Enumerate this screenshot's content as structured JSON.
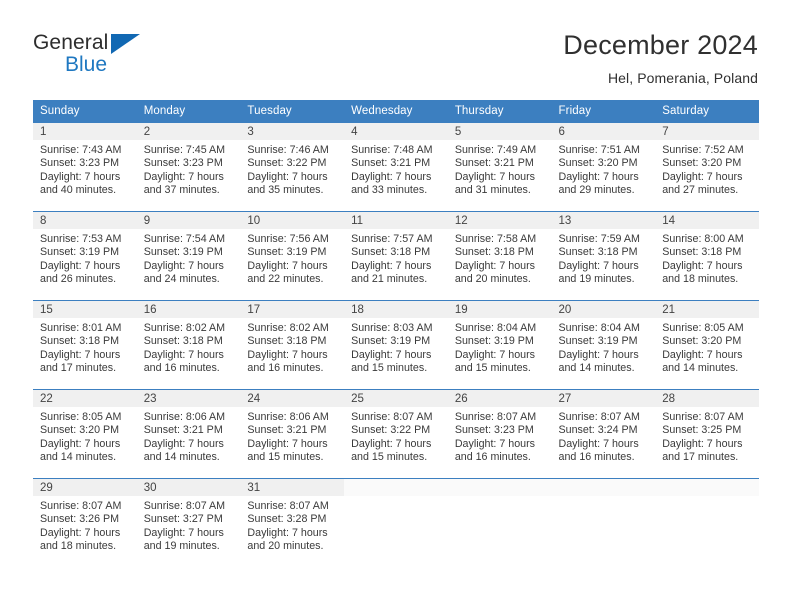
{
  "brand": {
    "name_top": "General",
    "name_bottom": "Blue",
    "accent_color": "#1168b3"
  },
  "header": {
    "title": "December 2024",
    "subtitle": "Hel, Pomerania, Poland"
  },
  "calendar": {
    "header_bg": "#3c7fc0",
    "daynum_bg": "#f0f0f0",
    "weekdays": [
      "Sunday",
      "Monday",
      "Tuesday",
      "Wednesday",
      "Thursday",
      "Friday",
      "Saturday"
    ],
    "weeks": [
      [
        {
          "day": "1",
          "sunrise": "Sunrise: 7:43 AM",
          "sunset": "Sunset: 3:23 PM",
          "daylight1": "Daylight: 7 hours",
          "daylight2": "and 40 minutes."
        },
        {
          "day": "2",
          "sunrise": "Sunrise: 7:45 AM",
          "sunset": "Sunset: 3:23 PM",
          "daylight1": "Daylight: 7 hours",
          "daylight2": "and 37 minutes."
        },
        {
          "day": "3",
          "sunrise": "Sunrise: 7:46 AM",
          "sunset": "Sunset: 3:22 PM",
          "daylight1": "Daylight: 7 hours",
          "daylight2": "and 35 minutes."
        },
        {
          "day": "4",
          "sunrise": "Sunrise: 7:48 AM",
          "sunset": "Sunset: 3:21 PM",
          "daylight1": "Daylight: 7 hours",
          "daylight2": "and 33 minutes."
        },
        {
          "day": "5",
          "sunrise": "Sunrise: 7:49 AM",
          "sunset": "Sunset: 3:21 PM",
          "daylight1": "Daylight: 7 hours",
          "daylight2": "and 31 minutes."
        },
        {
          "day": "6",
          "sunrise": "Sunrise: 7:51 AM",
          "sunset": "Sunset: 3:20 PM",
          "daylight1": "Daylight: 7 hours",
          "daylight2": "and 29 minutes."
        },
        {
          "day": "7",
          "sunrise": "Sunrise: 7:52 AM",
          "sunset": "Sunset: 3:20 PM",
          "daylight1": "Daylight: 7 hours",
          "daylight2": "and 27 minutes."
        }
      ],
      [
        {
          "day": "8",
          "sunrise": "Sunrise: 7:53 AM",
          "sunset": "Sunset: 3:19 PM",
          "daylight1": "Daylight: 7 hours",
          "daylight2": "and 26 minutes."
        },
        {
          "day": "9",
          "sunrise": "Sunrise: 7:54 AM",
          "sunset": "Sunset: 3:19 PM",
          "daylight1": "Daylight: 7 hours",
          "daylight2": "and 24 minutes."
        },
        {
          "day": "10",
          "sunrise": "Sunrise: 7:56 AM",
          "sunset": "Sunset: 3:19 PM",
          "daylight1": "Daylight: 7 hours",
          "daylight2": "and 22 minutes."
        },
        {
          "day": "11",
          "sunrise": "Sunrise: 7:57 AM",
          "sunset": "Sunset: 3:18 PM",
          "daylight1": "Daylight: 7 hours",
          "daylight2": "and 21 minutes."
        },
        {
          "day": "12",
          "sunrise": "Sunrise: 7:58 AM",
          "sunset": "Sunset: 3:18 PM",
          "daylight1": "Daylight: 7 hours",
          "daylight2": "and 20 minutes."
        },
        {
          "day": "13",
          "sunrise": "Sunrise: 7:59 AM",
          "sunset": "Sunset: 3:18 PM",
          "daylight1": "Daylight: 7 hours",
          "daylight2": "and 19 minutes."
        },
        {
          "day": "14",
          "sunrise": "Sunrise: 8:00 AM",
          "sunset": "Sunset: 3:18 PM",
          "daylight1": "Daylight: 7 hours",
          "daylight2": "and 18 minutes."
        }
      ],
      [
        {
          "day": "15",
          "sunrise": "Sunrise: 8:01 AM",
          "sunset": "Sunset: 3:18 PM",
          "daylight1": "Daylight: 7 hours",
          "daylight2": "and 17 minutes."
        },
        {
          "day": "16",
          "sunrise": "Sunrise: 8:02 AM",
          "sunset": "Sunset: 3:18 PM",
          "daylight1": "Daylight: 7 hours",
          "daylight2": "and 16 minutes."
        },
        {
          "day": "17",
          "sunrise": "Sunrise: 8:02 AM",
          "sunset": "Sunset: 3:18 PM",
          "daylight1": "Daylight: 7 hours",
          "daylight2": "and 16 minutes."
        },
        {
          "day": "18",
          "sunrise": "Sunrise: 8:03 AM",
          "sunset": "Sunset: 3:19 PM",
          "daylight1": "Daylight: 7 hours",
          "daylight2": "and 15 minutes."
        },
        {
          "day": "19",
          "sunrise": "Sunrise: 8:04 AM",
          "sunset": "Sunset: 3:19 PM",
          "daylight1": "Daylight: 7 hours",
          "daylight2": "and 15 minutes."
        },
        {
          "day": "20",
          "sunrise": "Sunrise: 8:04 AM",
          "sunset": "Sunset: 3:19 PM",
          "daylight1": "Daylight: 7 hours",
          "daylight2": "and 14 minutes."
        },
        {
          "day": "21",
          "sunrise": "Sunrise: 8:05 AM",
          "sunset": "Sunset: 3:20 PM",
          "daylight1": "Daylight: 7 hours",
          "daylight2": "and 14 minutes."
        }
      ],
      [
        {
          "day": "22",
          "sunrise": "Sunrise: 8:05 AM",
          "sunset": "Sunset: 3:20 PM",
          "daylight1": "Daylight: 7 hours",
          "daylight2": "and 14 minutes."
        },
        {
          "day": "23",
          "sunrise": "Sunrise: 8:06 AM",
          "sunset": "Sunset: 3:21 PM",
          "daylight1": "Daylight: 7 hours",
          "daylight2": "and 14 minutes."
        },
        {
          "day": "24",
          "sunrise": "Sunrise: 8:06 AM",
          "sunset": "Sunset: 3:21 PM",
          "daylight1": "Daylight: 7 hours",
          "daylight2": "and 15 minutes."
        },
        {
          "day": "25",
          "sunrise": "Sunrise: 8:07 AM",
          "sunset": "Sunset: 3:22 PM",
          "daylight1": "Daylight: 7 hours",
          "daylight2": "and 15 minutes."
        },
        {
          "day": "26",
          "sunrise": "Sunrise: 8:07 AM",
          "sunset": "Sunset: 3:23 PM",
          "daylight1": "Daylight: 7 hours",
          "daylight2": "and 16 minutes."
        },
        {
          "day": "27",
          "sunrise": "Sunrise: 8:07 AM",
          "sunset": "Sunset: 3:24 PM",
          "daylight1": "Daylight: 7 hours",
          "daylight2": "and 16 minutes."
        },
        {
          "day": "28",
          "sunrise": "Sunrise: 8:07 AM",
          "sunset": "Sunset: 3:25 PM",
          "daylight1": "Daylight: 7 hours",
          "daylight2": "and 17 minutes."
        }
      ],
      [
        {
          "day": "29",
          "sunrise": "Sunrise: 8:07 AM",
          "sunset": "Sunset: 3:26 PM",
          "daylight1": "Daylight: 7 hours",
          "daylight2": "and 18 minutes."
        },
        {
          "day": "30",
          "sunrise": "Sunrise: 8:07 AM",
          "sunset": "Sunset: 3:27 PM",
          "daylight1": "Daylight: 7 hours",
          "daylight2": "and 19 minutes."
        },
        {
          "day": "31",
          "sunrise": "Sunrise: 8:07 AM",
          "sunset": "Sunset: 3:28 PM",
          "daylight1": "Daylight: 7 hours",
          "daylight2": "and 20 minutes."
        },
        {
          "day": "",
          "sunrise": "",
          "sunset": "",
          "daylight1": "",
          "daylight2": ""
        },
        {
          "day": "",
          "sunrise": "",
          "sunset": "",
          "daylight1": "",
          "daylight2": ""
        },
        {
          "day": "",
          "sunrise": "",
          "sunset": "",
          "daylight1": "",
          "daylight2": ""
        },
        {
          "day": "",
          "sunrise": "",
          "sunset": "",
          "daylight1": "",
          "daylight2": ""
        }
      ]
    ]
  }
}
